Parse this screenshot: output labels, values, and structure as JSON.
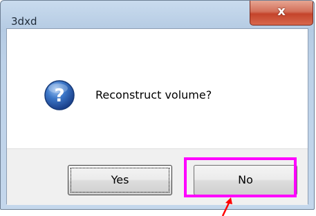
{
  "window": {
    "title": "3dxd",
    "close_glyph": "x"
  },
  "dialog": {
    "icon": "question-icon",
    "message": "Reconstruct volume?"
  },
  "buttons": {
    "yes_label": "Yes",
    "no_label": "No"
  },
  "annotation": {
    "highlight_color": "#ff00ff",
    "arrow_color": "#ff0000",
    "highlighted_button": "No"
  }
}
